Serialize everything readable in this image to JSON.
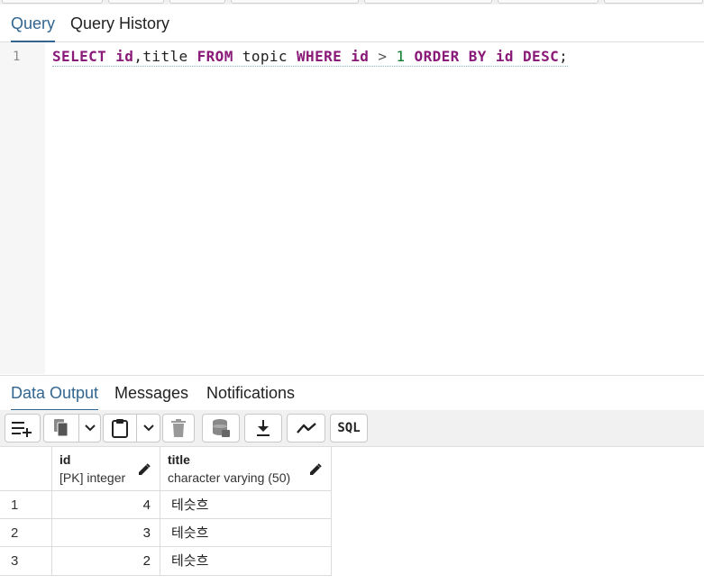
{
  "query_tabs": [
    {
      "label": "Query",
      "active": true
    },
    {
      "label": "Query History",
      "active": false
    }
  ],
  "editor": {
    "line_number": "1",
    "tokens": {
      "select": "SELECT",
      "col1": "id",
      "comma": ",",
      "col2": "title",
      "from": "FROM",
      "table": "topic",
      "where": "WHERE",
      "where_col": "id",
      "op": ">",
      "value": "1",
      "order": "ORDER",
      "by": "BY",
      "order_col": "id",
      "desc": "DESC",
      "semi": ";"
    }
  },
  "output_tabs": [
    {
      "label": "Data Output",
      "active": true
    },
    {
      "label": "Messages",
      "active": false
    },
    {
      "label": "Notifications",
      "active": false
    }
  ],
  "toolbar": {
    "sql_label": "SQL",
    "icons": [
      "add-row-icon",
      "copy-icon",
      "dropdown-icon",
      "paste-icon",
      "dropdown-icon",
      "delete-icon",
      "save-data-icon",
      "download-icon",
      "graph-icon",
      "sql-icon"
    ]
  },
  "grid": {
    "columns": [
      {
        "name": "id",
        "type": "[PK] integer"
      },
      {
        "name": "title",
        "type": "character varying (50)"
      }
    ],
    "rows": [
      {
        "n": "1",
        "id": "4",
        "title": "테슷흐"
      },
      {
        "n": "2",
        "id": "3",
        "title": "테슷흐"
      },
      {
        "n": "3",
        "id": "2",
        "title": "테슷흐"
      }
    ]
  },
  "colors": {
    "accent": "#326690",
    "keyword": "#8a1a78",
    "number": "#0b7a2b"
  }
}
